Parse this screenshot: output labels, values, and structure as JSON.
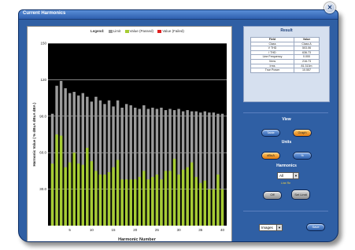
{
  "window": {
    "title": "Current Harmonics"
  },
  "legend": {
    "label": "Legend:",
    "items": [
      {
        "name": "Limit",
        "color": "#9c9c9c"
      },
      {
        "name": "Value (Passed)",
        "color": "#a6cc33"
      },
      {
        "name": "Value (Failed)",
        "color": "#e02020"
      }
    ]
  },
  "chart_data": {
    "type": "bar",
    "xlabel": "Harmonic Number",
    "ylabel": "Harmonic Value ( % dBuA dBuA dBA )",
    "ylim": [
      0,
      150
    ],
    "yticks": [
      "150",
      "120",
      "90.0",
      "60.0",
      "30.0"
    ],
    "xticks": [
      "5",
      "10",
      "15",
      "20",
      "25",
      "30",
      "35",
      "40"
    ],
    "categories": [
      1,
      2,
      3,
      4,
      5,
      6,
      7,
      8,
      9,
      10,
      11,
      12,
      13,
      14,
      15,
      16,
      17,
      18,
      19,
      20,
      21,
      22,
      23,
      24,
      25,
      26,
      27,
      28,
      29,
      30,
      31,
      32,
      33,
      34,
      35,
      36,
      37,
      38,
      39,
      40
    ],
    "series": [
      {
        "name": "Limit",
        "values": [
          92,
          115,
          119,
          113,
          109,
          110,
          107,
          109,
          106,
          102,
          106,
          103,
          100,
          103,
          98,
          103,
          97,
          100,
          99,
          97,
          96,
          99,
          96,
          97,
          96,
          97,
          95,
          96,
          95,
          96,
          94,
          95,
          94,
          94,
          93,
          94,
          93,
          93,
          92,
          92
        ]
      },
      {
        "name": "Value (Passed)",
        "values": [
          51,
          75,
          74,
          48,
          52,
          60,
          51,
          50,
          64,
          53,
          45,
          42,
          42,
          44,
          48,
          54,
          38,
          38,
          38,
          38,
          40,
          45,
          38,
          40,
          42,
          38,
          45,
          45,
          55,
          42,
          46,
          48,
          52,
          40,
          35,
          37,
          30,
          30,
          42,
          30
        ]
      }
    ]
  },
  "result": {
    "title": "Result",
    "header": [
      "Field",
      "Value"
    ],
    "rows": [
      [
        "Class",
        "Class A"
      ],
      [
        "V THD",
        "503.06"
      ],
      [
        "I THD",
        "636.73"
      ],
      [
        "Line Frequency",
        "0.000"
      ],
      [
        "Vrms",
        "216.73"
      ],
      [
        "Irms",
        "81.313m"
      ],
      [
        "True Power",
        "10.557"
      ]
    ]
  },
  "view": {
    "label": "View",
    "table": "Table",
    "graph": "Graph"
  },
  "units": {
    "label": "Units",
    "dbua": "dBuA",
    "percent": "%"
  },
  "harmonics": {
    "label": "Harmonics",
    "value": "All"
  },
  "small_caption": "Line Re",
  "toggle": {
    "off": "Off",
    "on": "Set Limit"
  },
  "bottom": {
    "format": "Images",
    "save": "Save"
  }
}
